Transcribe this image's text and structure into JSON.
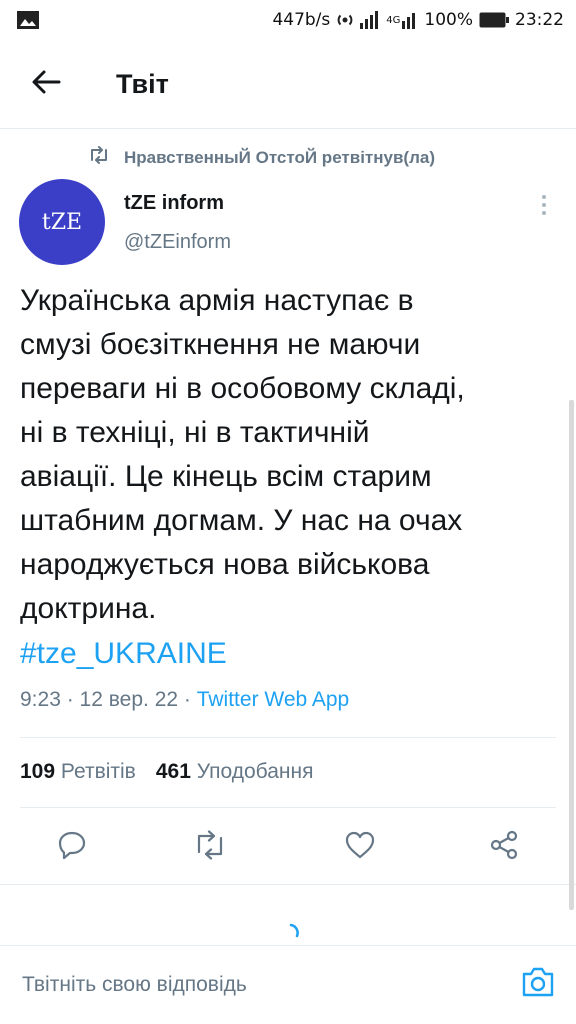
{
  "status_bar": {
    "speed": "447b/s",
    "network": "4G",
    "battery": "100%",
    "time": "23:22",
    "icons": [
      "image-icon",
      "hotspot-icon",
      "signal-icon",
      "battery-icon"
    ]
  },
  "header": {
    "title": "Твіт",
    "back_icon": "arrow-left-icon"
  },
  "retweet_context": {
    "text": "НравственныЙ ОтстоЙ ретвітнув(ла)",
    "icon": "retweet-icon"
  },
  "tweet": {
    "avatar_text": "tZE",
    "avatar_color": "#3b3fc8",
    "author_name": "tZE inform",
    "author_handle": "@tZEinform",
    "text": "Українська армія наступає в\nсмузі  боєзіткнення не маючи\nпереваги ні в особовому складі,\nні в техніці, ні в тактичній\nавіації.  Це кінець всім старим\nштабним догмам. У нас на очах\nнароджується нова військова\nдоктрина.",
    "hashtag": "#tze_UKRAINE",
    "time": "9:23",
    "date": "12 вер. 22",
    "separator": " · ",
    "source": "Twitter Web App",
    "retweets_count": "109",
    "retweets_label": "Ретвітів",
    "likes_count": "461",
    "likes_label": "Уподобання"
  },
  "actions": {
    "icons": [
      "reply-icon",
      "retweet-icon",
      "like-icon",
      "share-icon"
    ]
  },
  "reply": {
    "placeholder": "Твітніть свою відповідь",
    "camera_icon": "camera-icon"
  },
  "colors": {
    "accent": "#1da1f2",
    "secondary_text": "#657786",
    "divider": "#e6ecf0"
  }
}
